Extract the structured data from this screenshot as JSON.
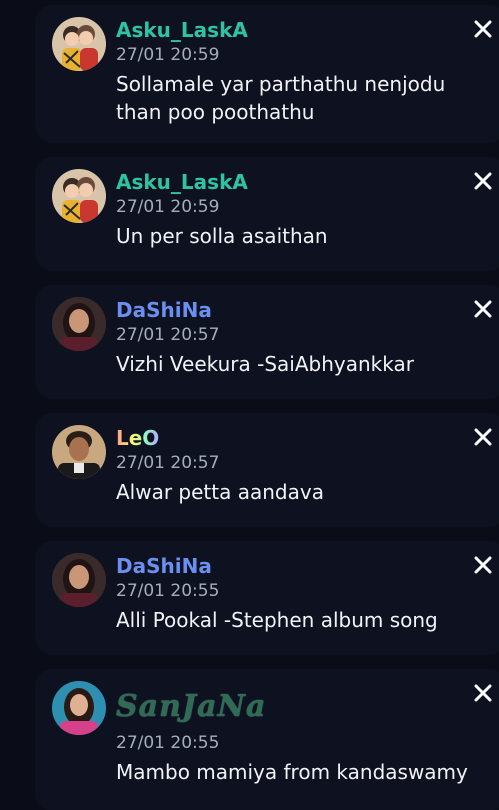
{
  "messages": [
    {
      "name": "Asku_LaskA",
      "time": "27/01 20:59",
      "text": "Sollamale yar parthathu nenjodu than poo poothathu",
      "avatar_icon": "couple-avatar-icon",
      "name_color": "#2ec4a3"
    },
    {
      "name": "Asku_LaskA",
      "time": "27/01 20:59",
      "text": "Un per solla asaithan",
      "avatar_icon": "couple-avatar-icon",
      "name_color": "#2ec4a3"
    },
    {
      "name": "DaShiNa",
      "time": "27/01 20:57",
      "text": "Vizhi Veekura -SaiAbhyankkar",
      "avatar_icon": "woman-avatar-icon",
      "name_color": "#6a8ff0"
    },
    {
      "name": "LeO",
      "time": "27/01 20:57",
      "text": "Alwar petta aandava",
      "avatar_icon": "man-avatar-icon",
      "name_color": "gradient"
    },
    {
      "name": "DaShiNa",
      "time": "27/01 20:55",
      "text": "Alli Pookal -Stephen album song",
      "avatar_icon": "woman-avatar-icon",
      "name_color": "#6a8ff0"
    },
    {
      "name": "SanJaNa",
      "time": "27/01 20:55",
      "text": "Mambo mamiya from kandaswamy",
      "avatar_icon": "woman-avatar-icon",
      "name_color": "#2f6b55"
    }
  ],
  "icons": {
    "close": "close-icon"
  },
  "colors": {
    "background": "#0a0d18",
    "card": "#0e1220",
    "timestamp": "#a6adbd",
    "message_text": "#f1f3f7"
  }
}
